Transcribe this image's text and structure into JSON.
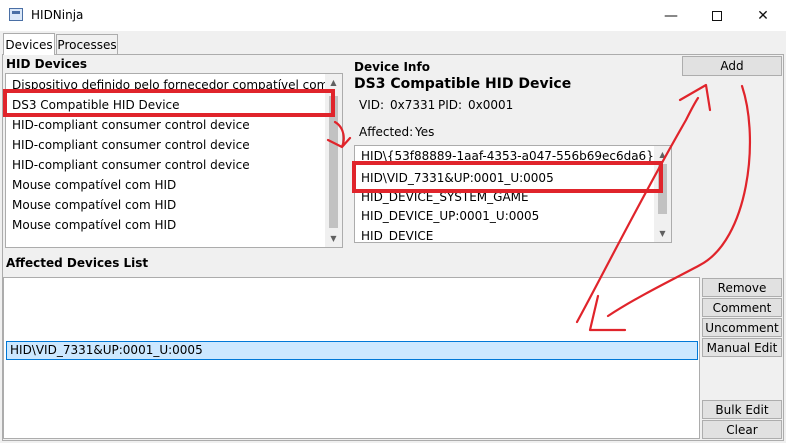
{
  "window": {
    "title": "HIDNinja",
    "icon": "app-icon",
    "controls": [
      "minimize-icon",
      "maximize-icon",
      "close-icon"
    ]
  },
  "tabs": [
    {
      "label": "Devices",
      "active": true
    },
    {
      "label": "Processes",
      "active": false
    }
  ],
  "hid_devices": {
    "label": "HID Devices",
    "items": [
      "Dispositivo definido pelo fornecedor compatível com HID",
      "DS3 Compatible HID Device",
      "HID-compliant consumer control device",
      "HID-compliant consumer control device",
      "HID-compliant consumer control device",
      "Mouse compatível com HID",
      "Mouse compatível com HID",
      "Mouse compatível com HID"
    ],
    "selected_index": 1
  },
  "device_info": {
    "label": "Device Info",
    "name": "DS3 Compatible HID Device",
    "vid_label": "VID:",
    "vid": "0x7331",
    "pid_label": "PID:",
    "pid": "0x0001",
    "affected_label": "Affected:",
    "affected": "Yes",
    "ids": [
      "HID\\{53f88889-1aaf-4353-a047-556b69ec6da6}",
      "HID\\VID_7331&UP:0001_U:0005",
      "HID_DEVICE_SYSTEM_GAME",
      "HID_DEVICE_UP:0001_U:0005",
      "HID_DEVICE"
    ],
    "selected_index": 1
  },
  "buttons": {
    "add": "Add",
    "remove": "Remove",
    "comment": "Comment",
    "uncomment": "Uncomment",
    "manual_edit": "Manual Edit",
    "bulk_edit": "Bulk Edit",
    "clear": "Clear"
  },
  "affected_list": {
    "label": "Affected Devices List",
    "items": [
      "HID\\VID_7331&UP:0001_U:0005"
    ]
  },
  "annotation": {
    "color": "#e0242b"
  }
}
